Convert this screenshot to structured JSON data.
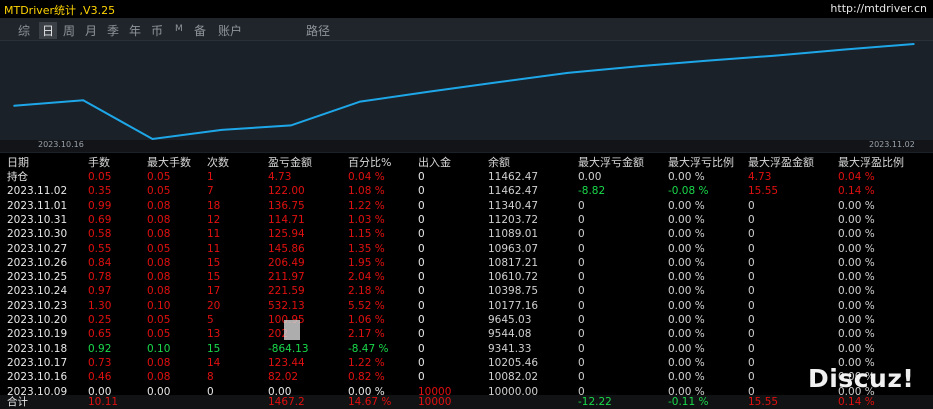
{
  "app": {
    "title": "MTDriver统计 ,V3.25",
    "url": "http://mtdriver.cn"
  },
  "tabs": [
    {
      "label": "综",
      "active": false
    },
    {
      "label": "日",
      "active": true
    },
    {
      "label": "周",
      "active": false
    },
    {
      "label": "月",
      "active": false
    },
    {
      "label": "季",
      "active": false
    },
    {
      "label": "年",
      "active": false
    },
    {
      "label": "币",
      "active": false
    },
    {
      "label": "M",
      "active": false
    },
    {
      "label": "备",
      "active": false
    },
    {
      "label": "账户",
      "active": false
    },
    {
      "label": "路径",
      "active": false
    }
  ],
  "chart_data": {
    "type": "line",
    "x": [
      "2023.10.16",
      "2023.10.17",
      "2023.10.18",
      "2023.10.19",
      "2023.10.20",
      "2023.10.23",
      "2023.10.24",
      "2023.10.25",
      "2023.10.26",
      "2023.10.27",
      "2023.10.30",
      "2023.10.31",
      "2023.11.01",
      "2023.11.02"
    ],
    "values": [
      10082.02,
      10205.46,
      9341.33,
      9544.08,
      9645.03,
      10177.16,
      10398.75,
      10610.72,
      10817.21,
      10963.07,
      11089.01,
      11203.72,
      11340.47,
      11462.47
    ],
    "xlabels": {
      "start": "2023.10.16",
      "end": "2023.11.02"
    },
    "line_color": "#1ea7e8"
  },
  "table": {
    "headers": [
      "日期",
      "手数",
      "最大手数",
      "次数",
      "盈亏金额",
      "百分比%",
      "出入金",
      "余额",
      "最大浮亏金额",
      "最大浮亏比例",
      "最大浮盈金额",
      "最大浮盈比例"
    ],
    "rows": [
      [
        "持仓",
        "0.05",
        "0.05",
        "1",
        "4.73",
        "0.04 %",
        "0",
        "11462.47",
        "0.00",
        "0.00 %",
        "4.73",
        "0.04 %"
      ],
      [
        "2023.11.02",
        "0.35",
        "0.05",
        "7",
        "122.00",
        "1.08 %",
        "0",
        "11462.47",
        "-8.82",
        "-0.08 %",
        "15.55",
        "0.14 %"
      ],
      [
        "2023.11.01",
        "0.99",
        "0.08",
        "18",
        "136.75",
        "1.22 %",
        "0",
        "11340.47",
        "0",
        "0.00 %",
        "0",
        "0.00 %"
      ],
      [
        "2023.10.31",
        "0.69",
        "0.08",
        "12",
        "114.71",
        "1.03 %",
        "0",
        "11203.72",
        "0",
        "0.00 %",
        "0",
        "0.00 %"
      ],
      [
        "2023.10.30",
        "0.58",
        "0.08",
        "11",
        "125.94",
        "1.15 %",
        "0",
        "11089.01",
        "0",
        "0.00 %",
        "0",
        "0.00 %"
      ],
      [
        "2023.10.27",
        "0.55",
        "0.05",
        "11",
        "145.86",
        "1.35 %",
        "0",
        "10963.07",
        "0",
        "0.00 %",
        "0",
        "0.00 %"
      ],
      [
        "2023.10.26",
        "0.84",
        "0.08",
        "15",
        "206.49",
        "1.95 %",
        "0",
        "10817.21",
        "0",
        "0.00 %",
        "0",
        "0.00 %"
      ],
      [
        "2023.10.25",
        "0.78",
        "0.08",
        "15",
        "211.97",
        "2.04 %",
        "0",
        "10610.72",
        "0",
        "0.00 %",
        "0",
        "0.00 %"
      ],
      [
        "2023.10.24",
        "0.97",
        "0.08",
        "17",
        "221.59",
        "2.18 %",
        "0",
        "10398.75",
        "0",
        "0.00 %",
        "0",
        "0.00 %"
      ],
      [
        "2023.10.23",
        "1.30",
        "0.10",
        "20",
        "532.13",
        "5.52 %",
        "0",
        "10177.16",
        "0",
        "0.00 %",
        "0",
        "0.00 %"
      ],
      [
        "2023.10.20",
        "0.25",
        "0.05",
        "5",
        "100.95",
        "1.06 %",
        "0",
        "9645.03",
        "0",
        "0.00 %",
        "0",
        "0.00 %"
      ],
      [
        "2023.10.19",
        "0.65",
        "0.05",
        "13",
        "202",
        "2.17 %",
        "0",
        "9544.08",
        "0",
        "0.00 %",
        "0",
        "0.00 %"
      ],
      [
        "2023.10.18",
        "0.92",
        "0.10",
        "15",
        "-864.13",
        "-8.47 %",
        "0",
        "9341.33",
        "0",
        "0.00 %",
        "0",
        "0.00 %"
      ],
      [
        "2023.10.17",
        "0.73",
        "0.08",
        "14",
        "123.44",
        "1.22 %",
        "0",
        "10205.46",
        "0",
        "0.00 %",
        "0",
        "0.00 %"
      ],
      [
        "2023.10.16",
        "0.46",
        "0.08",
        "8",
        "82.02",
        "0.82 %",
        "0",
        "10082.02",
        "0",
        "0.00 %",
        "0",
        "0.00 %"
      ],
      [
        "2023.10.09",
        "0.00",
        "0.00",
        "0",
        "0.00",
        "0.00 %",
        "10000",
        "10000.00",
        "0",
        "0.00 %",
        "0",
        "0.00 %"
      ]
    ],
    "totals": [
      "合计",
      "10.11",
      "",
      "",
      "1467.2",
      "14.67 %",
      "10000",
      "",
      "-12.22",
      "-0.11 %",
      "15.55",
      "0.14 %"
    ]
  },
  "watermark": "Discuz!"
}
